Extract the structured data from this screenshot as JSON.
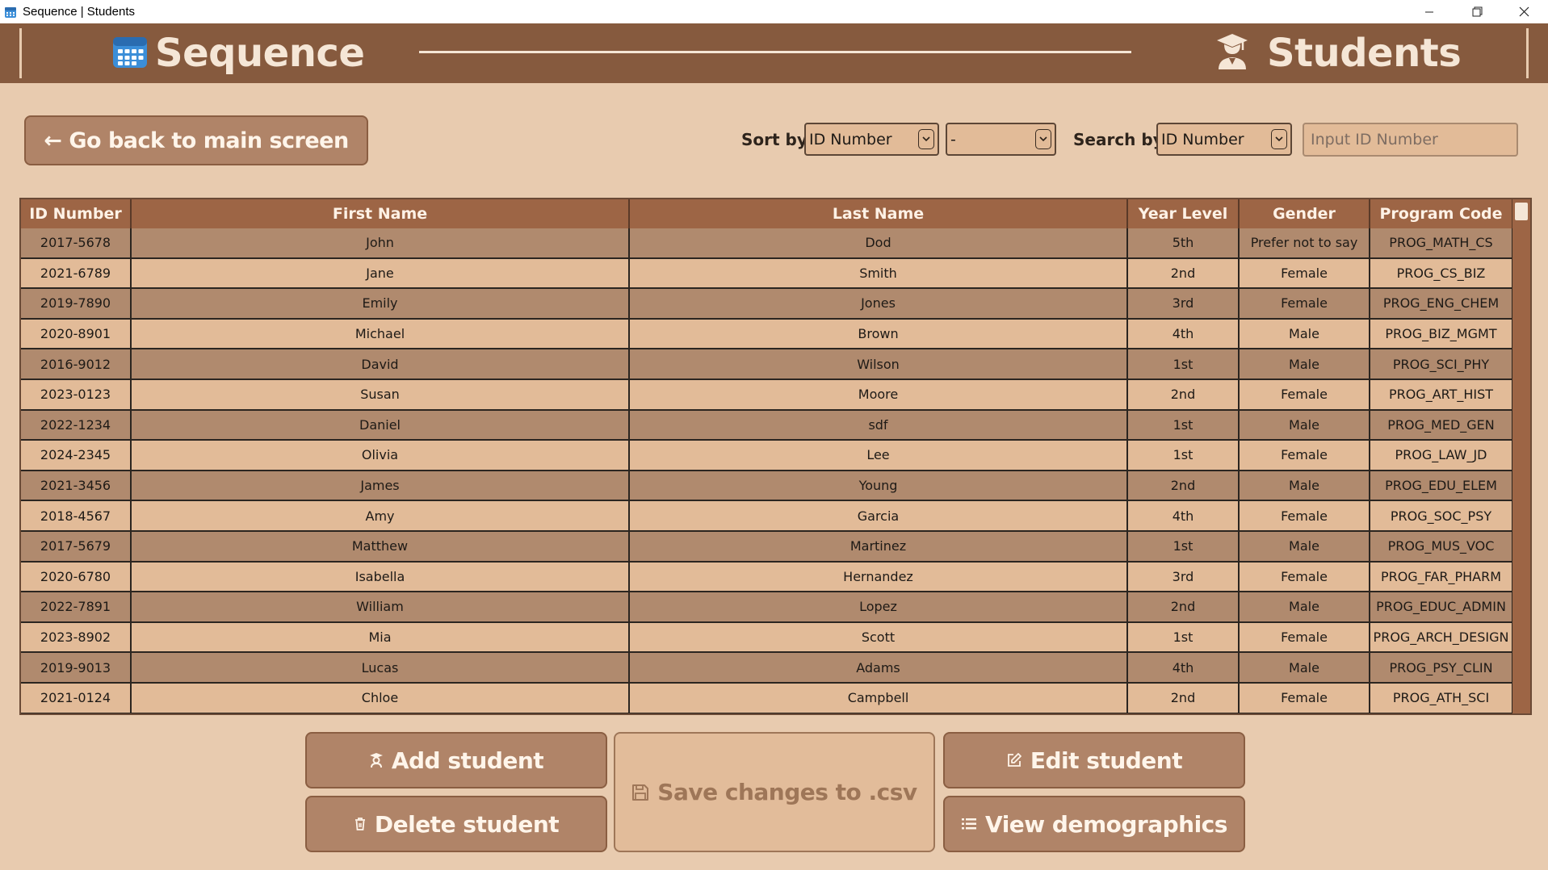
{
  "window": {
    "title": "Sequence | Students",
    "minimize_glyph": "—",
    "restore_glyph": "❐",
    "close_glyph": "✕"
  },
  "header": {
    "brand": "Sequence",
    "section": "Students",
    "brand_icon": "calendar-icon",
    "section_icon": "graduation-cap-icon"
  },
  "back_button": {
    "label": "← Go back to main screen"
  },
  "sort": {
    "label": "Sort by",
    "field_value": "ID Number",
    "order_value": "-"
  },
  "search": {
    "label": "Search by",
    "field_value": "ID Number",
    "placeholder": "Input ID Number"
  },
  "table": {
    "columns": [
      "ID Number",
      "First Name",
      "Last Name",
      "Year Level",
      "Gender",
      "Program Code"
    ],
    "rows": [
      [
        "2017-5678",
        "John",
        "Dod",
        "5th",
        "Prefer not to say",
        "PROG_MATH_CS"
      ],
      [
        "2021-6789",
        "Jane",
        "Smith",
        "2nd",
        "Female",
        "PROG_CS_BIZ"
      ],
      [
        "2019-7890",
        "Emily",
        "Jones",
        "3rd",
        "Female",
        "PROG_ENG_CHEM"
      ],
      [
        "2020-8901",
        "Michael",
        "Brown",
        "4th",
        "Male",
        "PROG_BIZ_MGMT"
      ],
      [
        "2016-9012",
        "David",
        "Wilson",
        "1st",
        "Male",
        "PROG_SCI_PHY"
      ],
      [
        "2023-0123",
        "Susan",
        "Moore",
        "2nd",
        "Female",
        "PROG_ART_HIST"
      ],
      [
        "2022-1234",
        "Daniel",
        "sdf",
        "1st",
        "Male",
        "PROG_MED_GEN"
      ],
      [
        "2024-2345",
        "Olivia",
        "Lee",
        "1st",
        "Female",
        "PROG_LAW_JD"
      ],
      [
        "2021-3456",
        "James",
        "Young",
        "2nd",
        "Male",
        "PROG_EDU_ELEM"
      ],
      [
        "2018-4567",
        "Amy",
        "Garcia",
        "4th",
        "Female",
        "PROG_SOC_PSY"
      ],
      [
        "2017-5679",
        "Matthew",
        "Martinez",
        "1st",
        "Male",
        "PROG_MUS_VOC"
      ],
      [
        "2020-6780",
        "Isabella",
        "Hernandez",
        "3rd",
        "Female",
        "PROG_FAR_PHARM"
      ],
      [
        "2022-7891",
        "William",
        "Lopez",
        "2nd",
        "Male",
        "PROG_EDUC_ADMIN"
      ],
      [
        "2023-8902",
        "Mia",
        "Scott",
        "1st",
        "Female",
        "PROG_ARCH_DESIGN"
      ],
      [
        "2019-9013",
        "Lucas",
        "Adams",
        "4th",
        "Male",
        "PROG_PSY_CLIN"
      ],
      [
        "2021-0124",
        "Chloe",
        "Campbell",
        "2nd",
        "Female",
        "PROG_ATH_SCI"
      ]
    ]
  },
  "actions": {
    "add": "Add student",
    "delete": "Delete student",
    "save": "Save changes to .csv",
    "edit": "Edit student",
    "demographics": "View demographics"
  },
  "colors": {
    "header_bg": "#865A3E",
    "page_bg": "#E8CBAF",
    "button_bg": "#B08468",
    "row_dark": "#B08A6E",
    "row_light": "#E2BB98",
    "table_header": "#9D6545"
  }
}
